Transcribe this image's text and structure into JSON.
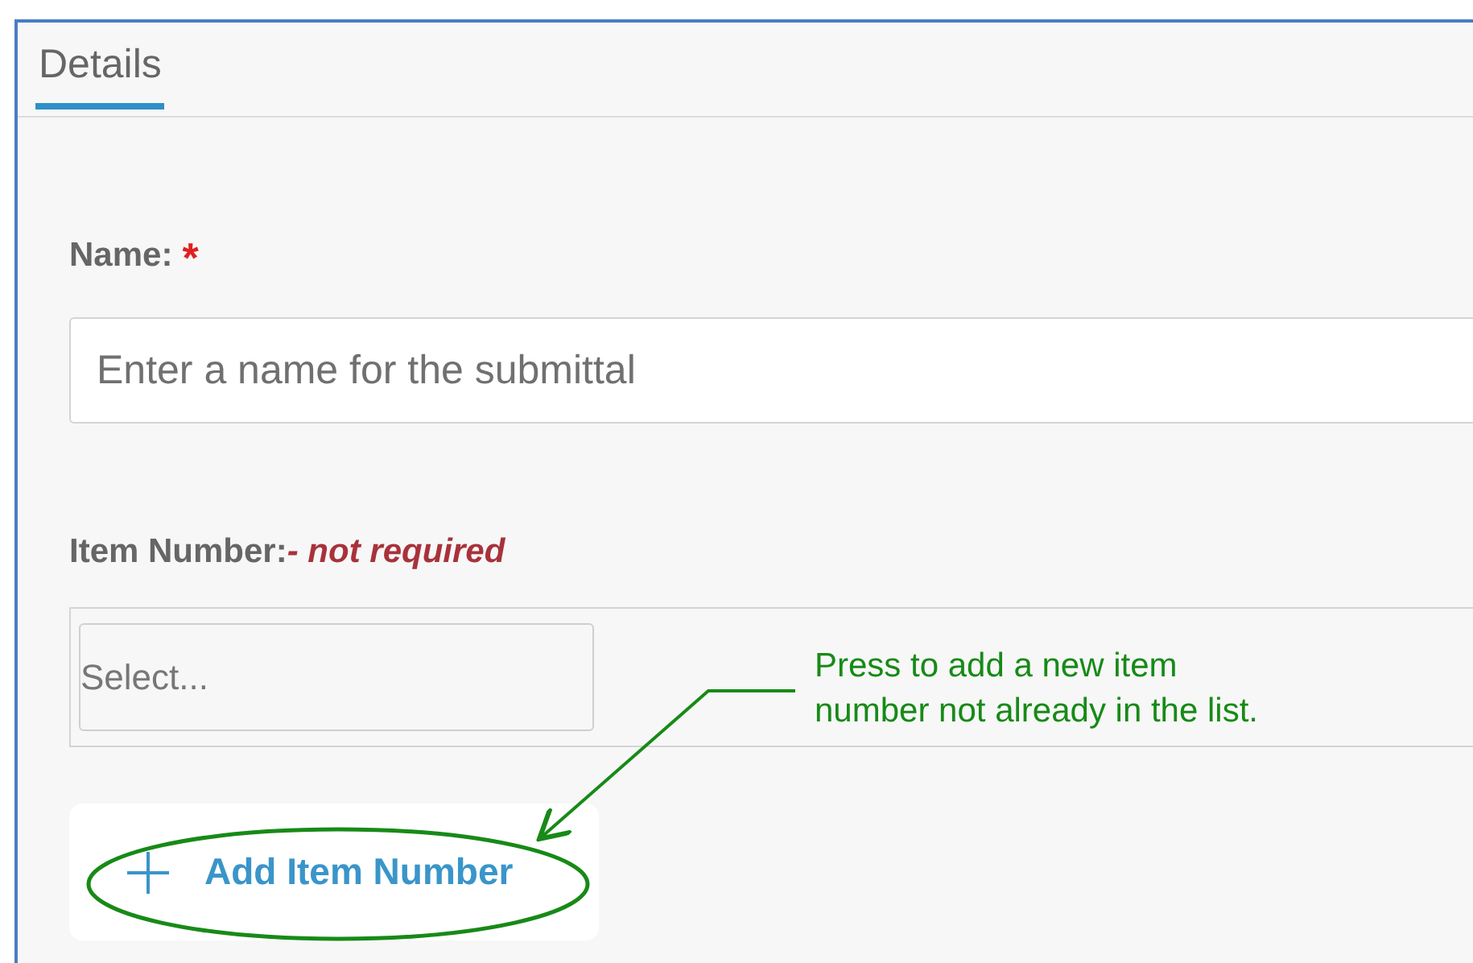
{
  "tabs": [
    {
      "label": "Details",
      "selected": true
    }
  ],
  "name_field": {
    "label": "Name:",
    "required_mark": "*",
    "placeholder": "Enter a name for the submittal"
  },
  "item_number_field": {
    "label": "Item Number:",
    "note": "- not required",
    "placeholder": "Select..."
  },
  "add_button": {
    "label": "Add Item Number"
  },
  "annotation": {
    "lines": [
      "Press to add a new item",
      "number not already in the list."
    ]
  }
}
